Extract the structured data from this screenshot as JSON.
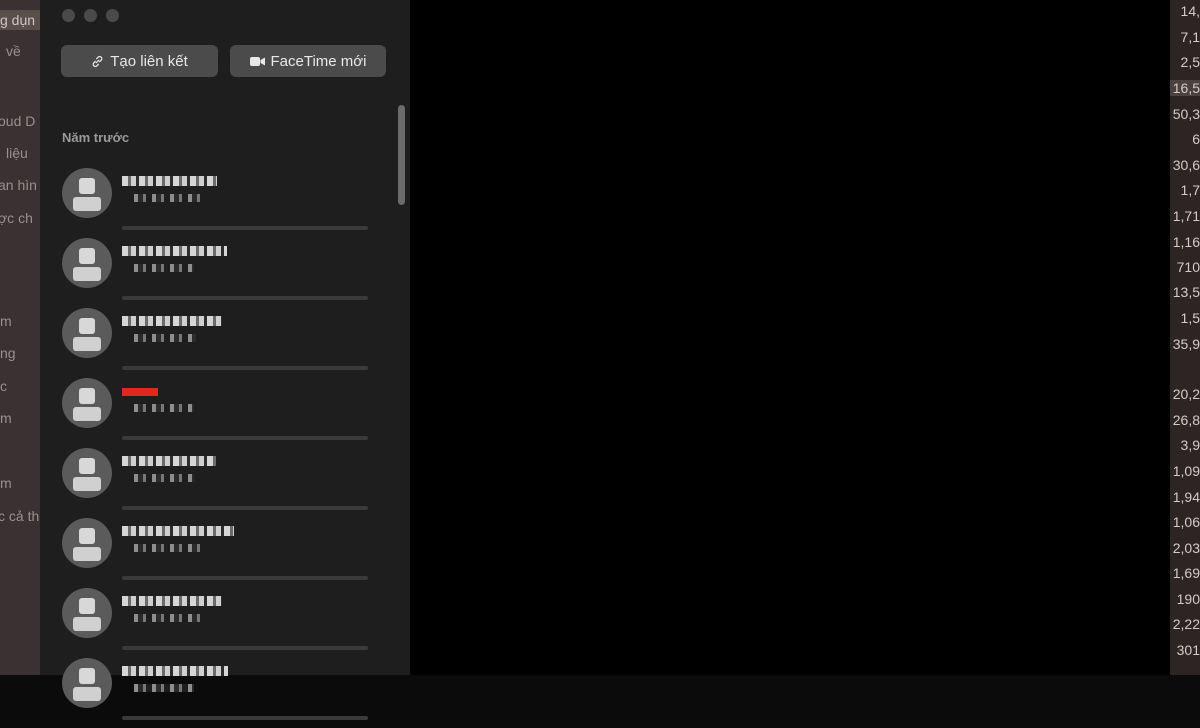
{
  "bg_left": {
    "items": [
      {
        "label": "g dụn",
        "selected": true
      },
      {
        "label": "về",
        "selected": false
      },
      {
        "label": "oud D",
        "selected": false
      },
      {
        "label": "liệu",
        "selected": false
      },
      {
        "label": "an hìn",
        "selected": false
      },
      {
        "label": "ợc ch",
        "selected": false
      },
      {
        "label": "m",
        "selected": false
      },
      {
        "label": "ng",
        "selected": false
      },
      {
        "label": "c",
        "selected": false
      },
      {
        "label": "m",
        "selected": false
      },
      {
        "label": "m",
        "selected": false
      },
      {
        "label": "c cả th",
        "selected": false
      }
    ]
  },
  "bg_right": {
    "sizes": [
      "14,",
      "7,1",
      "2,5",
      "16,5",
      "50,3",
      "6",
      "30,6",
      "1,7",
      "1,71",
      "1,16",
      "710",
      "13,5",
      "1,5",
      "35,9",
      "20,2",
      "26,8",
      "3,9",
      "1,09",
      "1,94",
      "1,06",
      "2,03",
      "1,69",
      "190",
      "2,22",
      "301"
    ]
  },
  "toolbar": {
    "create_link_label": "Tạo liên kết",
    "new_facetime_label": "FaceTime mới"
  },
  "calls": {
    "section_title": "Năm trước",
    "rows": [
      {
        "name_width": 95,
        "sub_width": 70,
        "missed": false
      },
      {
        "name_width": 105,
        "sub_width": 60,
        "missed": false
      },
      {
        "name_width": 100,
        "sub_width": 62,
        "missed": false
      },
      {
        "name_width": 36,
        "sub_width": 60,
        "missed": true
      },
      {
        "name_width": 94,
        "sub_width": 60,
        "missed": false
      },
      {
        "name_width": 112,
        "sub_width": 70,
        "missed": false
      },
      {
        "name_width": 100,
        "sub_width": 70,
        "missed": false
      },
      {
        "name_width": 106,
        "sub_width": 60,
        "missed": false
      }
    ]
  },
  "colors": {
    "missed_call": "#e0281e"
  }
}
